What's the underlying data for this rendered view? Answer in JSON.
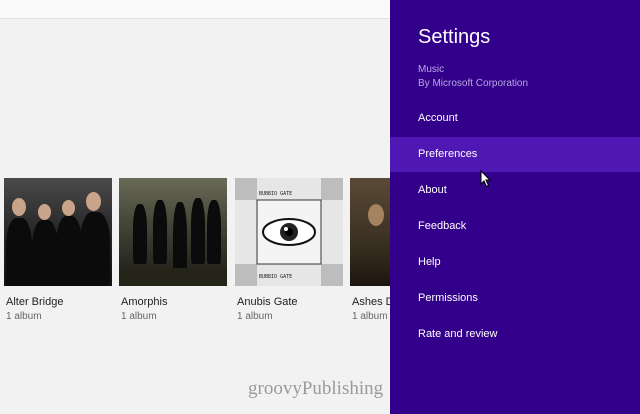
{
  "albums": [
    {
      "name": "Alter Bridge",
      "count": "1 album"
    },
    {
      "name": "Amorphis",
      "count": "1 album"
    },
    {
      "name": "Anubis Gate",
      "count": "1 album"
    },
    {
      "name": "Ashes D",
      "count": "1 album"
    }
  ],
  "anubis_art_text": "BUBBIO GATE",
  "watermark": "groovyPublishing",
  "settings": {
    "title": "Settings",
    "app_name": "Music",
    "app_by": "By Microsoft Corporation",
    "items": [
      {
        "label": "Account"
      },
      {
        "label": "Preferences"
      },
      {
        "label": "About"
      },
      {
        "label": "Feedback"
      },
      {
        "label": "Help"
      },
      {
        "label": "Permissions"
      },
      {
        "label": "Rate and review"
      }
    ],
    "active_item": "Preferences"
  },
  "colors": {
    "settings_bg": "#32008a",
    "settings_active": "#4f17b3",
    "content_bg": "#f2f2f2"
  }
}
